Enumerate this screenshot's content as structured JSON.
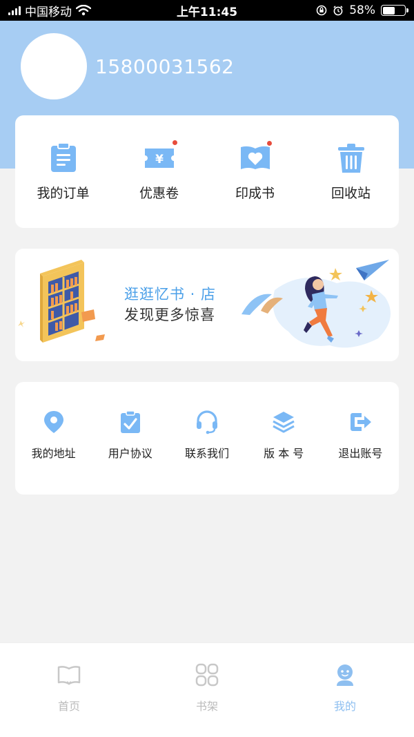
{
  "status_bar": {
    "carrier": "中国移动",
    "time": "上午11:45",
    "battery": "58%",
    "battery_level": 0.58
  },
  "profile": {
    "phone": "15800031562"
  },
  "orders": [
    {
      "label": "我的订单",
      "icon": "clipboard-icon"
    },
    {
      "label": "优惠卷",
      "icon": "coupon-icon",
      "badge": true
    },
    {
      "label": "印成书",
      "icon": "heart-book-icon",
      "badge": true
    },
    {
      "label": "回收站",
      "icon": "trash-icon"
    }
  ],
  "banner": {
    "title": "逛逛忆书 · 店",
    "subtitle": "发现更多惊喜"
  },
  "services": [
    {
      "label": "我的地址",
      "icon": "location-pin-icon"
    },
    {
      "label": "用户协议",
      "icon": "agreement-icon"
    },
    {
      "label": "联系我们",
      "icon": "headset-icon"
    },
    {
      "label": "版 本 号",
      "icon": "layers-icon"
    },
    {
      "label": "退出账号",
      "icon": "logout-icon"
    }
  ],
  "tabs": [
    {
      "label": "首页",
      "icon": "book-open-icon",
      "active": false
    },
    {
      "label": "书架",
      "icon": "grid-icon",
      "active": false
    },
    {
      "label": "我的",
      "icon": "user-icon",
      "active": true
    }
  ],
  "colors": {
    "primary": "#a7cdf3",
    "icon_blue": "#7ab8f5",
    "accent_text": "#4a9fe8",
    "badge_red": "#e74c3c",
    "background": "#f2f2f2"
  }
}
